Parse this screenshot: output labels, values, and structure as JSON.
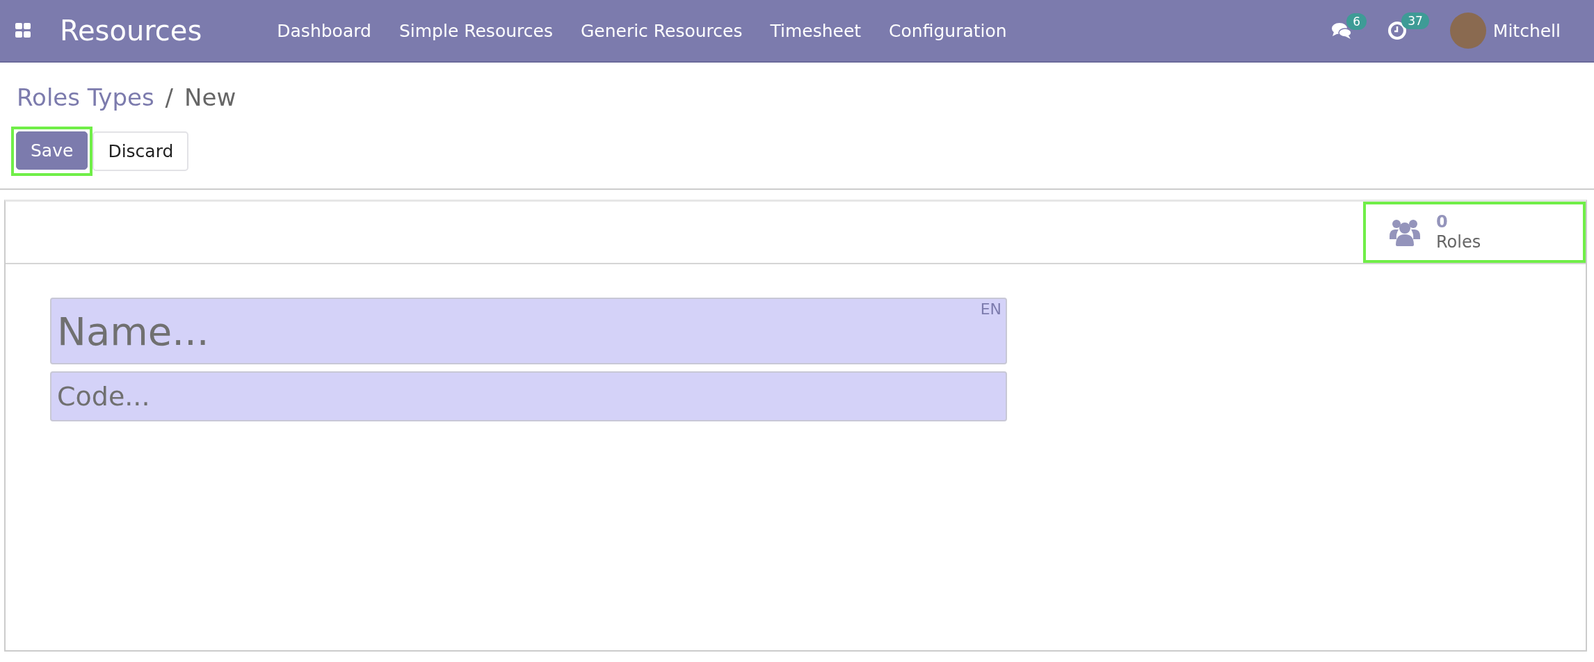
{
  "navbar": {
    "app_name": "Resources",
    "menu": [
      "Dashboard",
      "Simple Resources",
      "Generic Resources",
      "Timesheet",
      "Configuration"
    ],
    "messages_count": "6",
    "activities_count": "37",
    "user": "Mitchell"
  },
  "breadcrumb": {
    "parent": "Roles Types",
    "separator": "/",
    "current": "New"
  },
  "buttons": [
    {
      "label": "Save",
      "kind": "primary",
      "highlighted": true
    },
    {
      "label": "Discard",
      "kind": "secondary"
    }
  ],
  "stat_button": {
    "value": "0",
    "label": "Roles",
    "highlighted": true
  },
  "fields": [
    {
      "kind": "title",
      "placeholder": "Name...",
      "language": "EN"
    },
    {
      "kind": "subtitle",
      "placeholder": "Code..."
    }
  ]
}
